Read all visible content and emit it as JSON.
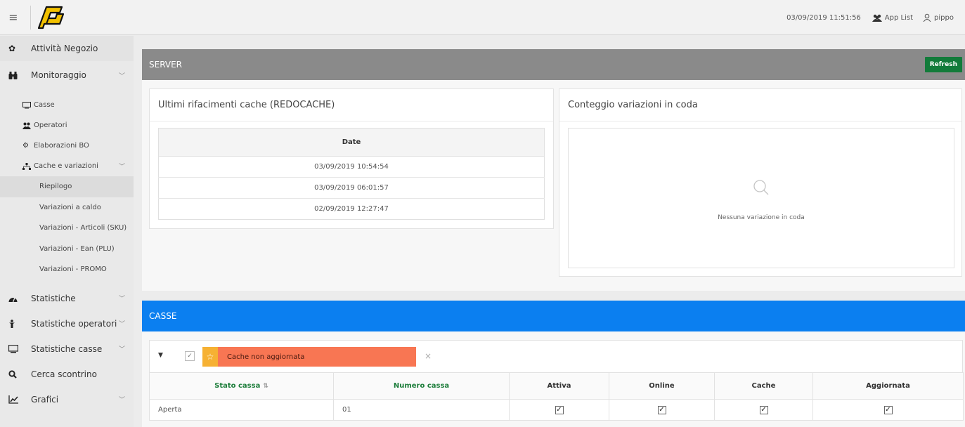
{
  "topbar": {
    "datetime": "03/09/2019 11:51:56",
    "app_list": "App List",
    "user": "pippo"
  },
  "sidebar": {
    "items": [
      {
        "label": "Attività Negozio"
      },
      {
        "label": "Monitoraggio"
      },
      {
        "label": "Statistiche"
      },
      {
        "label": "Statistiche operatori"
      },
      {
        "label": "Statistiche casse"
      },
      {
        "label": "Cerca scontrino"
      },
      {
        "label": "Grafici"
      }
    ],
    "monitoraggio_sub": [
      {
        "label": "Casse"
      },
      {
        "label": "Operatori"
      },
      {
        "label": "Elaborazioni BO"
      },
      {
        "label": "Cache e variazioni"
      }
    ],
    "cache_sub": [
      {
        "label": "Riepilogo"
      },
      {
        "label": "Variazioni a caldo"
      },
      {
        "label": "Variazioni - Articoli (SKU)"
      },
      {
        "label": "Variazioni - Ean (PLU)"
      },
      {
        "label": "Variazioni - PROMO"
      }
    ]
  },
  "server": {
    "title": "SERVER",
    "refresh": "Refresh",
    "redocache": {
      "title": "Ultimi rifacimenti cache (REDOCACHE)",
      "column": "Date",
      "rows": [
        "03/09/2019 10:54:54",
        "03/09/2019 06:01:57",
        "02/09/2019 12:27:47"
      ]
    },
    "variazioni": {
      "title": "Conteggio variazioni in coda",
      "empty": "Nessuna variazione in coda"
    }
  },
  "casse": {
    "title": "CASSE",
    "filter_tag": "Cache non aggiornata",
    "columns": [
      "Stato cassa",
      "Numero cassa",
      "Attiva",
      "Online",
      "Cache",
      "Aggiornata"
    ],
    "rows": [
      {
        "stato": "Aperta",
        "numero": "01",
        "attiva": true,
        "online": true,
        "cache": true,
        "aggiornata": true
      }
    ]
  },
  "colors": {
    "server_header": "#8a8a8a",
    "casse_header": "#0b7ff0",
    "refresh_button": "#127b3a",
    "tag_bg": "#f87653",
    "tag_star": "#f6b133"
  }
}
